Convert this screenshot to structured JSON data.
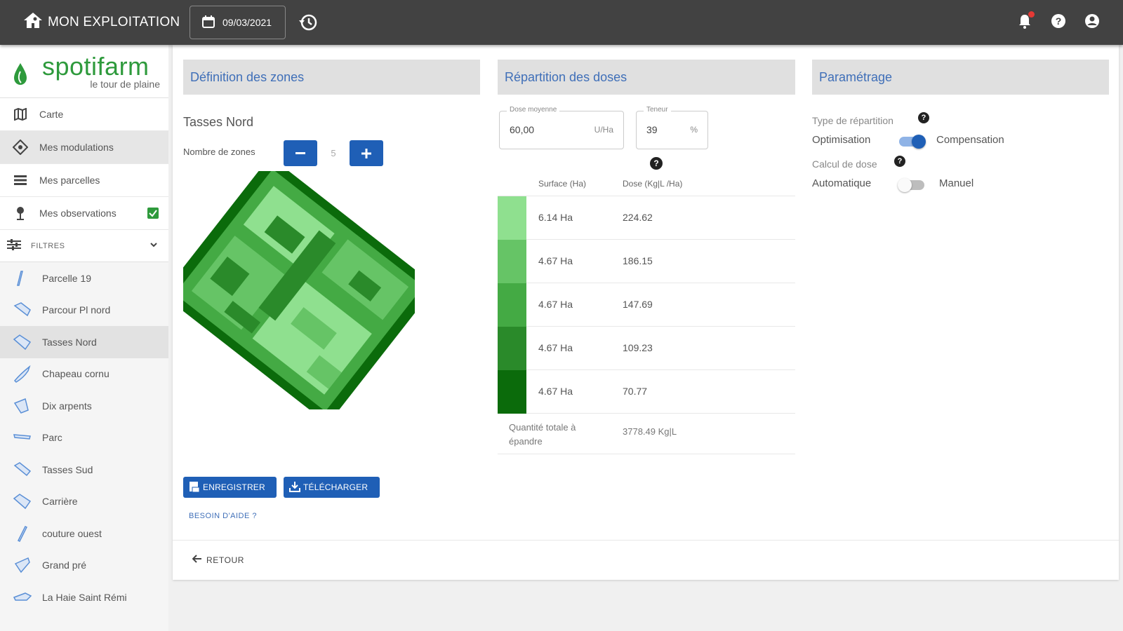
{
  "topbar": {
    "home_label": "MON EXPLOITATION",
    "date": "09/03/2021",
    "icons": [
      "home-icon",
      "calendar-icon",
      "history-icon",
      "bell-icon",
      "help-icon",
      "account-icon"
    ]
  },
  "sidebar": {
    "brand": "spotifarm",
    "subtitle": "le tour de plaine",
    "nav": [
      {
        "label": "Carte",
        "icon": "map-icon"
      },
      {
        "label": "Mes modulations",
        "icon": "modulation-icon"
      },
      {
        "label": "Mes parcelles",
        "icon": "list-icon"
      },
      {
        "label": "Mes observations",
        "icon": "pin-icon"
      }
    ],
    "filters_label": "FILTRES",
    "parcels": [
      "Parcelle 19",
      "Parcour Pl nord",
      "Tasses Nord",
      "Chapeau cornu",
      "Dix arpents",
      "Parc",
      "Tasses Sud",
      "Carrière",
      "couture ouest",
      "Grand pré",
      "La Haie Saint Rémi"
    ]
  },
  "zones": {
    "header": "Définition des zones",
    "parcel_name": "Tasses Nord",
    "count_label": "Nombre de zones",
    "count": "5",
    "save_label": "ENREGISTRER",
    "download_label": "TÉLÉCHARGER",
    "help_label": "BESOIN D'AIDE ?",
    "back_label": "RETOUR"
  },
  "doses": {
    "header": "Répartition des doses",
    "avg_label": "Dose moyenne",
    "avg_value": "60,00",
    "avg_unit": "U/Ha",
    "content_label": "Teneur",
    "content_value": "39",
    "content_unit": "%",
    "col_surface": "Surface (Ha)",
    "col_dose": "Dose (Kg|L /Ha)",
    "rows": [
      {
        "surface": "6.14 Ha",
        "dose": "224.62",
        "color": "#8fe08f"
      },
      {
        "surface": "4.67 Ha",
        "dose": "186.15",
        "color": "#66c466"
      },
      {
        "surface": "4.67 Ha",
        "dose": "147.69",
        "color": "#44aa44"
      },
      {
        "surface": "4.67 Ha",
        "dose": "109.23",
        "color": "#2a8a2a"
      },
      {
        "surface": "4.67 Ha",
        "dose": "70.77",
        "color": "#0b6b0b"
      }
    ],
    "total_label": "Quantité totale à épandre",
    "total_value": "3778.49 Kg|L"
  },
  "params": {
    "header": "Paramétrage",
    "type_label": "Type de répartition",
    "opt1": "Optimisation",
    "opt2": "Compensation",
    "calc_label": "Calcul de dose",
    "calc1": "Automatique",
    "calc2": "Manuel",
    "type_toggle_on": true,
    "calc_toggle_on": false
  },
  "colors": {
    "topbar": "#424242",
    "primary": "#1f5fb6",
    "brand_green": "#2e9a3c",
    "header_text": "#3f6fb8"
  }
}
